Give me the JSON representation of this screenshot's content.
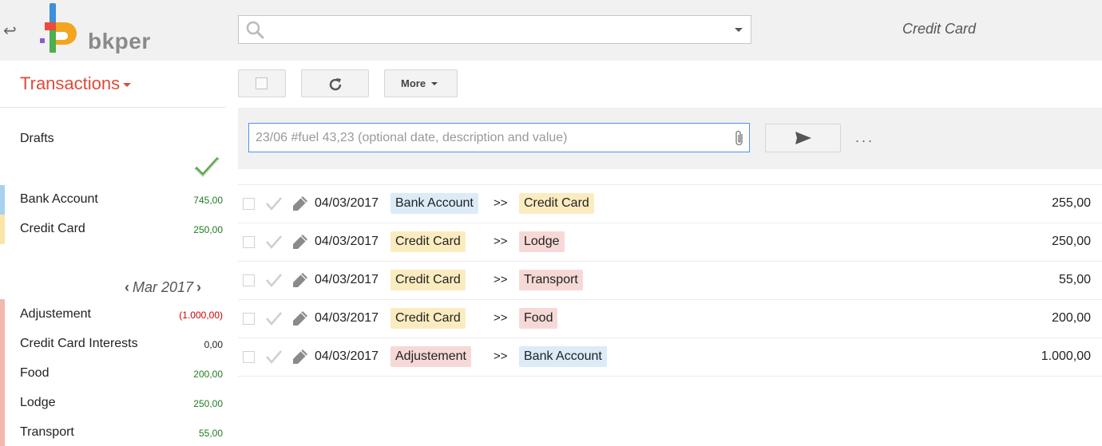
{
  "header": {
    "logo_text": "bkper",
    "search_placeholder": "",
    "book_title": "Credit Card",
    "icons": {
      "back": "back-arrow-icon",
      "search": "search-icon",
      "dropdown": "caret-down-icon"
    }
  },
  "toolbar": {
    "view_title": "Transactions",
    "more_label": "More"
  },
  "entry": {
    "placeholder": "23/06 #fuel 43,23 (optional date, description and value)",
    "value": "",
    "dots_label": "..."
  },
  "sidebar": {
    "drafts_label": "Drafts",
    "accounts": [
      {
        "name": "Bank Account",
        "balance": "745,00",
        "stripe": "#a7d2ef",
        "tone": "green"
      },
      {
        "name": "Credit Card",
        "balance": "250,00",
        "stripe": "#fbe5a6",
        "tone": "green"
      }
    ],
    "period": {
      "label": "Mar 2017",
      "prev": "‹",
      "next": "›"
    },
    "categories": [
      {
        "name": "Adjustement",
        "balance": "(1.000,00)",
        "tone": "red"
      },
      {
        "name": "Credit Card Interests",
        "balance": "0,00",
        "tone": "black"
      },
      {
        "name": "Food",
        "balance": "200,00",
        "tone": "green"
      },
      {
        "name": "Lodge",
        "balance": "250,00",
        "tone": "green"
      },
      {
        "name": "Transport",
        "balance": "55,00",
        "tone": "green"
      }
    ],
    "category_stripe": "#f3b8b0"
  },
  "transactions": [
    {
      "date": "04/03/2017",
      "from": "Bank Account",
      "from_color": "#dcebf7",
      "arrows": ">>",
      "to": "Credit Card",
      "to_color": "#fbecc0",
      "amount": "255,00"
    },
    {
      "date": "04/03/2017",
      "from": "Credit Card",
      "from_color": "#fbecc0",
      "arrows": ">>",
      "to": "Lodge",
      "to_color": "#f6d9d6",
      "amount": "250,00"
    },
    {
      "date": "04/03/2017",
      "from": "Credit Card",
      "from_color": "#fbecc0",
      "arrows": ">>",
      "to": "Transport",
      "to_color": "#f6d9d6",
      "amount": "55,00"
    },
    {
      "date": "04/03/2017",
      "from": "Credit Card",
      "from_color": "#fbecc0",
      "arrows": ">>",
      "to": "Food",
      "to_color": "#f6d9d6",
      "amount": "200,00"
    },
    {
      "date": "04/03/2017",
      "from": "Adjustement",
      "from_color": "#f6d9d6",
      "arrows": ">>",
      "to": "Bank Account",
      "to_color": "#dcebf7",
      "amount": "1.000,00"
    }
  ]
}
